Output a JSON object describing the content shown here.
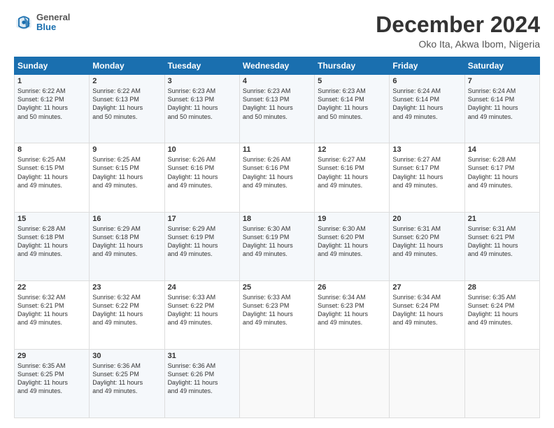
{
  "header": {
    "logo_general": "General",
    "logo_blue": "Blue",
    "month_title": "December 2024",
    "location": "Oko Ita, Akwa Ibom, Nigeria"
  },
  "weekdays": [
    "Sunday",
    "Monday",
    "Tuesday",
    "Wednesday",
    "Thursday",
    "Friday",
    "Saturday"
  ],
  "weeks": [
    [
      {
        "day": "1",
        "text": "Sunrise: 6:22 AM\nSunset: 6:12 PM\nDaylight: 11 hours\nand 50 minutes."
      },
      {
        "day": "2",
        "text": "Sunrise: 6:22 AM\nSunset: 6:13 PM\nDaylight: 11 hours\nand 50 minutes."
      },
      {
        "day": "3",
        "text": "Sunrise: 6:23 AM\nSunset: 6:13 PM\nDaylight: 11 hours\nand 50 minutes."
      },
      {
        "day": "4",
        "text": "Sunrise: 6:23 AM\nSunset: 6:13 PM\nDaylight: 11 hours\nand 50 minutes."
      },
      {
        "day": "5",
        "text": "Sunrise: 6:23 AM\nSunset: 6:14 PM\nDaylight: 11 hours\nand 50 minutes."
      },
      {
        "day": "6",
        "text": "Sunrise: 6:24 AM\nSunset: 6:14 PM\nDaylight: 11 hours\nand 49 minutes."
      },
      {
        "day": "7",
        "text": "Sunrise: 6:24 AM\nSunset: 6:14 PM\nDaylight: 11 hours\nand 49 minutes."
      }
    ],
    [
      {
        "day": "8",
        "text": "Sunrise: 6:25 AM\nSunset: 6:15 PM\nDaylight: 11 hours\nand 49 minutes."
      },
      {
        "day": "9",
        "text": "Sunrise: 6:25 AM\nSunset: 6:15 PM\nDaylight: 11 hours\nand 49 minutes."
      },
      {
        "day": "10",
        "text": "Sunrise: 6:26 AM\nSunset: 6:16 PM\nDaylight: 11 hours\nand 49 minutes."
      },
      {
        "day": "11",
        "text": "Sunrise: 6:26 AM\nSunset: 6:16 PM\nDaylight: 11 hours\nand 49 minutes."
      },
      {
        "day": "12",
        "text": "Sunrise: 6:27 AM\nSunset: 6:16 PM\nDaylight: 11 hours\nand 49 minutes."
      },
      {
        "day": "13",
        "text": "Sunrise: 6:27 AM\nSunset: 6:17 PM\nDaylight: 11 hours\nand 49 minutes."
      },
      {
        "day": "14",
        "text": "Sunrise: 6:28 AM\nSunset: 6:17 PM\nDaylight: 11 hours\nand 49 minutes."
      }
    ],
    [
      {
        "day": "15",
        "text": "Sunrise: 6:28 AM\nSunset: 6:18 PM\nDaylight: 11 hours\nand 49 minutes."
      },
      {
        "day": "16",
        "text": "Sunrise: 6:29 AM\nSunset: 6:18 PM\nDaylight: 11 hours\nand 49 minutes."
      },
      {
        "day": "17",
        "text": "Sunrise: 6:29 AM\nSunset: 6:19 PM\nDaylight: 11 hours\nand 49 minutes."
      },
      {
        "day": "18",
        "text": "Sunrise: 6:30 AM\nSunset: 6:19 PM\nDaylight: 11 hours\nand 49 minutes."
      },
      {
        "day": "19",
        "text": "Sunrise: 6:30 AM\nSunset: 6:20 PM\nDaylight: 11 hours\nand 49 minutes."
      },
      {
        "day": "20",
        "text": "Sunrise: 6:31 AM\nSunset: 6:20 PM\nDaylight: 11 hours\nand 49 minutes."
      },
      {
        "day": "21",
        "text": "Sunrise: 6:31 AM\nSunset: 6:21 PM\nDaylight: 11 hours\nand 49 minutes."
      }
    ],
    [
      {
        "day": "22",
        "text": "Sunrise: 6:32 AM\nSunset: 6:21 PM\nDaylight: 11 hours\nand 49 minutes."
      },
      {
        "day": "23",
        "text": "Sunrise: 6:32 AM\nSunset: 6:22 PM\nDaylight: 11 hours\nand 49 minutes."
      },
      {
        "day": "24",
        "text": "Sunrise: 6:33 AM\nSunset: 6:22 PM\nDaylight: 11 hours\nand 49 minutes."
      },
      {
        "day": "25",
        "text": "Sunrise: 6:33 AM\nSunset: 6:23 PM\nDaylight: 11 hours\nand 49 minutes."
      },
      {
        "day": "26",
        "text": "Sunrise: 6:34 AM\nSunset: 6:23 PM\nDaylight: 11 hours\nand 49 minutes."
      },
      {
        "day": "27",
        "text": "Sunrise: 6:34 AM\nSunset: 6:24 PM\nDaylight: 11 hours\nand 49 minutes."
      },
      {
        "day": "28",
        "text": "Sunrise: 6:35 AM\nSunset: 6:24 PM\nDaylight: 11 hours\nand 49 minutes."
      }
    ],
    [
      {
        "day": "29",
        "text": "Sunrise: 6:35 AM\nSunset: 6:25 PM\nDaylight: 11 hours\nand 49 minutes."
      },
      {
        "day": "30",
        "text": "Sunrise: 6:36 AM\nSunset: 6:25 PM\nDaylight: 11 hours\nand 49 minutes."
      },
      {
        "day": "31",
        "text": "Sunrise: 6:36 AM\nSunset: 6:26 PM\nDaylight: 11 hours\nand 49 minutes."
      },
      {
        "day": "",
        "text": ""
      },
      {
        "day": "",
        "text": ""
      },
      {
        "day": "",
        "text": ""
      },
      {
        "day": "",
        "text": ""
      }
    ]
  ]
}
